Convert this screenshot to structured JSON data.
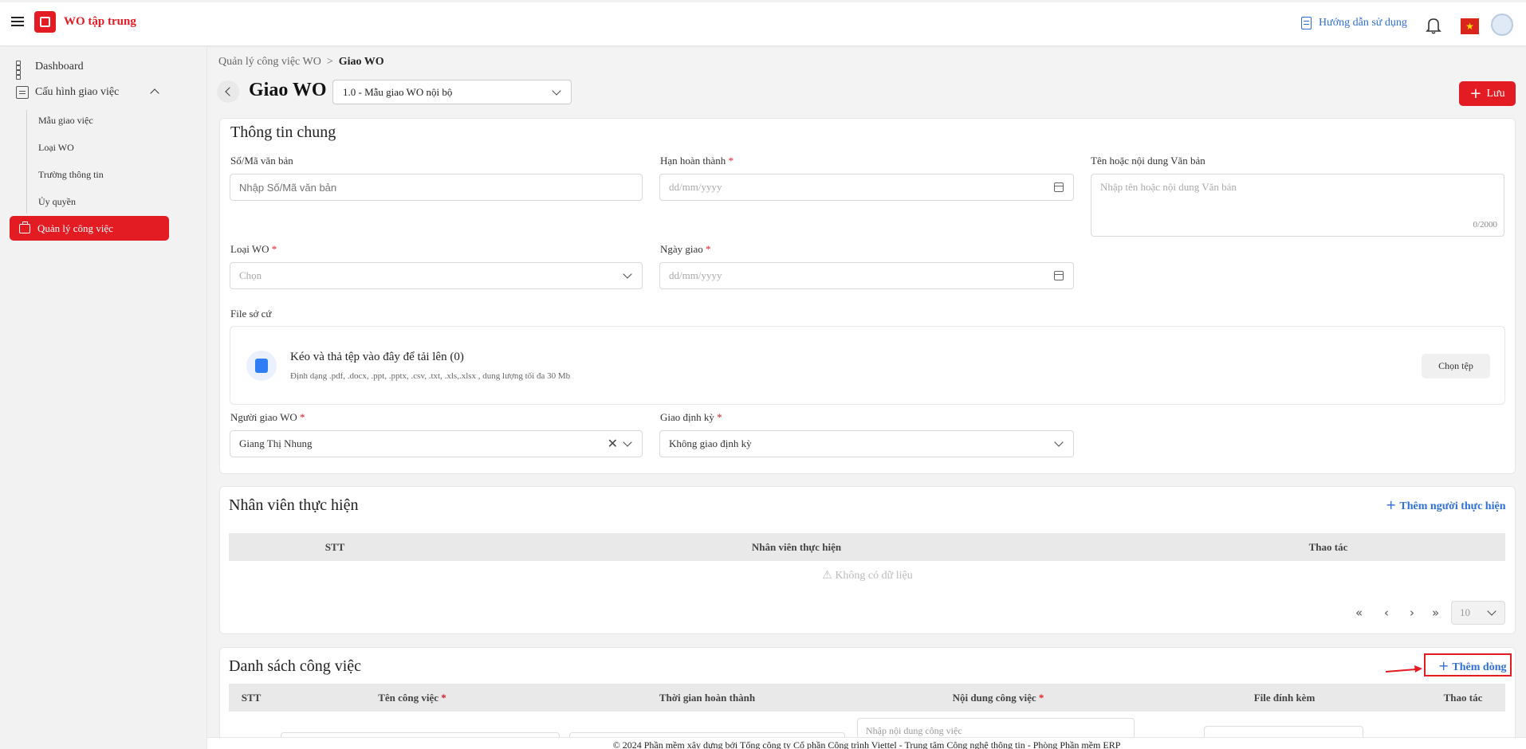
{
  "app": {
    "title": "WO tập trung"
  },
  "header": {
    "help_label": "Hướng dẫn sử dụng",
    "flag_glyph": "★"
  },
  "sidebar": {
    "items": [
      {
        "label": "Dashboard",
        "icon": "dashboard-icon"
      },
      {
        "label": "Cấu hình giao việc",
        "icon": "config-icon"
      }
    ],
    "sub_items": [
      "Mẫu giao việc",
      "Loại WO",
      "Trường thông tin",
      "Ủy quyền"
    ],
    "active_item": "Quản lý công việc"
  },
  "breadcrumb": {
    "parent": "Quản lý công việc WO",
    "separator": ">",
    "current": "Giao WO"
  },
  "page": {
    "title": "Giao WO",
    "template_value": "1.0 - Mẫu giao WO nội bộ",
    "save_label": "Lưu"
  },
  "general": {
    "title": "Thông tin chung",
    "doc_number": {
      "label": "Số/Mã văn bản",
      "placeholder": "Nhập Số/Mã văn bản"
    },
    "due_date": {
      "label": "Hạn hoàn thành",
      "placeholder": "dd/mm/yyyy"
    },
    "doc_content": {
      "label": "Tên hoặc nội dung Văn bản",
      "placeholder": "Nhập tên hoặc nội dung Văn bản",
      "counter": "0/2000"
    },
    "wo_type": {
      "label": "Loại WO",
      "placeholder": "Chọn"
    },
    "assign_date": {
      "label": "Ngày giao",
      "placeholder": "dd/mm/yyyy"
    },
    "file": {
      "label": "File sở cứ",
      "drop_text": "Kéo và thả tệp vào đây để tải lên (0)",
      "formats": "Định dạng .pdf, .docx, .ppt, .pptx, .csv, .txt, .xls,.xlsx , dung lượng tối đa 30 Mb",
      "choose_label": "Chọn tệp"
    },
    "assigner": {
      "label": "Người giao WO",
      "value": "Giang Thị Nhung"
    },
    "periodic": {
      "label": "Giao định kỳ",
      "value": "Không giao định kỳ"
    },
    "required_mark": "*"
  },
  "staff": {
    "title": "Nhân viên thực hiện",
    "add_label": "Thêm người thực hiện",
    "columns": [
      "STT",
      "Nhân viên thực hiện",
      "Thao tác"
    ],
    "empty": "⚠ Không có dữ liệu",
    "pager": {
      "first": "«",
      "prev": "‹",
      "next": "›",
      "last": "»",
      "page_size": "10"
    }
  },
  "tasks": {
    "title": "Danh sách công việc",
    "add_label": "Thêm dòng",
    "columns": [
      "STT",
      "Tên công việc",
      "Thời gian hoàn thành",
      "Nội dung công việc",
      "File đính kèm",
      "Thao tác"
    ],
    "content_placeholder": "Nhập nội dung công việc"
  },
  "footer": {
    "text": "© 2024 Phần mềm xây dựng bởi Tổng công ty Cổ phần Công trình Viettel - Trung tâm Công nghệ thông tin - Phòng Phần mềm ERP"
  },
  "colors": {
    "brand": "#e31b23",
    "link": "#2f6fd6"
  }
}
